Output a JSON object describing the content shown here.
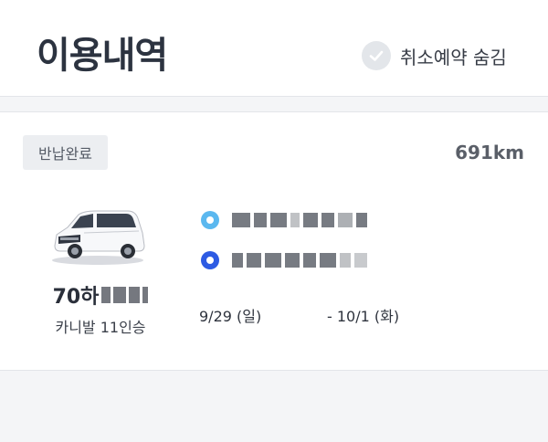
{
  "header": {
    "title": "이용내역",
    "hide_cancelled_label": "취소예약 숨김"
  },
  "reservation": {
    "status": "반납완료",
    "distance": "691km",
    "plate_prefix": "70하",
    "car_model": "카니발 11인승",
    "start_date": "9/29 (일)",
    "end_date": "- 10/1 (화)",
    "start_dot_color": "#5bb8ef",
    "end_dot_color": "#2d5be3"
  }
}
